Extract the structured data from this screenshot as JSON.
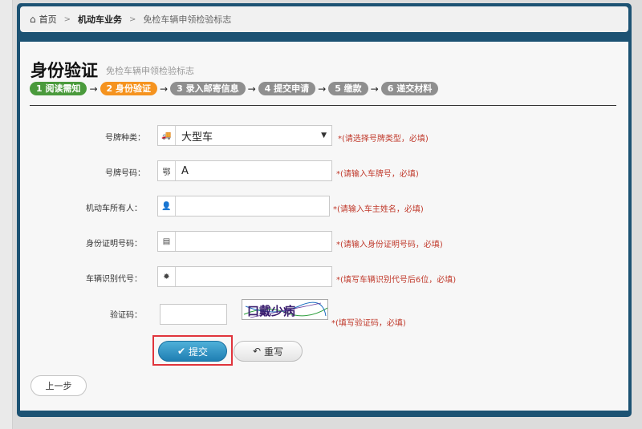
{
  "breadcrumb": {
    "home": "首页",
    "section": "机动车业务",
    "current": "免检车辆申领检验标志"
  },
  "page": {
    "title": "身份验证",
    "subtitle": "免检车辆申领检验标志"
  },
  "steps": [
    {
      "label": "1 阅读需知",
      "state": "done"
    },
    {
      "label": "2 身份验证",
      "state": "active"
    },
    {
      "label": "3 录入邮寄信息",
      "state": "pending"
    },
    {
      "label": "4 提交申请",
      "state": "pending"
    },
    {
      "label": "5 缴款",
      "state": "pending"
    },
    {
      "label": "6 递交材料",
      "state": "pending"
    }
  ],
  "form": {
    "plate_type": {
      "label": "号牌种类：",
      "value": "大型车",
      "hint": "*(请选择号牌类型，必填)"
    },
    "plate_number": {
      "label": "号牌号码：",
      "prefix": "鄂",
      "value": "A",
      "hint": "*(请输入车牌号，必填)"
    },
    "owner": {
      "label": "机动车所有人：",
      "value": "",
      "hint": "*(请输入车主姓名，必填)"
    },
    "id_number": {
      "label": "身份证明号码：",
      "value": "",
      "hint": "*(请输入身份证明号码，必填)"
    },
    "vin": {
      "label": "车辆识别代号：",
      "value": "",
      "hint": "*(填写车辆识别代号后6位，必填)"
    },
    "captcha": {
      "label": "验证码：",
      "value": "",
      "image_text": "口戴少病",
      "hint": "*(填写验证码，必填)"
    }
  },
  "buttons": {
    "submit": "提交",
    "reset": "重写",
    "prev": "上一步"
  },
  "colors": {
    "frame": "#1c5273",
    "step_done": "#4a9a3c",
    "step_active": "#f5931f",
    "step_pending": "#8f8f8f",
    "hint": "#c0392b",
    "highlight": "#e0343c"
  }
}
